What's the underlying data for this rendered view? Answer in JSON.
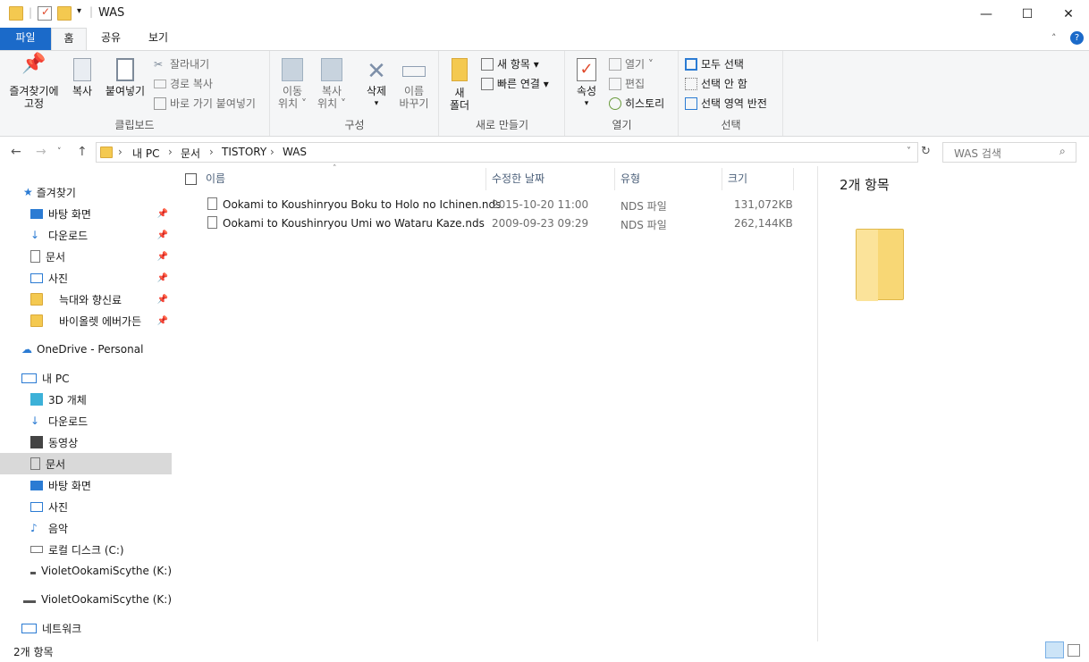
{
  "window": {
    "title": "WAS",
    "minimize_glyph": "—",
    "maximize_glyph": "☐",
    "close_glyph": "✕"
  },
  "ribbon_tabs": [
    "파일",
    "홈",
    "공유",
    "보기"
  ],
  "ribbon": {
    "clipboard": {
      "pin_label": "즐겨찾기에\n고정",
      "copy_label": "복사",
      "paste_label": "붙여넣기",
      "cut_label": "잘라내기",
      "copy_path_label": "경로 복사",
      "paste_shortcut_label": "바로 가기 붙여넣기",
      "group_label": "클립보드"
    },
    "organize": {
      "move_label": "이동\n위치 ˅",
      "copy_to_label": "복사\n위치 ˅",
      "delete_label": "삭제",
      "rename_label": "이름\n바꾸기",
      "group_label": "구성"
    },
    "new": {
      "new_folder_label": "새\n폴더",
      "new_item_label": "새 항목 ▾",
      "easy_access_label": "빠른 연결 ▾",
      "group_label": "새로 만들기"
    },
    "open": {
      "properties_label": "속성",
      "open_label": "열기 ˅",
      "edit_label": "편집",
      "history_label": "히스토리",
      "group_label": "열기"
    },
    "select": {
      "select_all_label": "모두 선택",
      "select_none_label": "선택 안 함",
      "invert_label": "선택 영역 반전",
      "group_label": "선택"
    }
  },
  "address": {
    "breadcrumb": [
      "내 PC",
      "문서",
      "TISTORY",
      "WAS"
    ],
    "search_placeholder": "WAS 검색"
  },
  "nav": {
    "quick_access": "즐겨찾기",
    "pinned": [
      {
        "label": "바탕 화면",
        "icon": "desktop-icon"
      },
      {
        "label": "다운로드",
        "icon": "download-icon"
      },
      {
        "label": "문서",
        "icon": "document-icon"
      },
      {
        "label": "사진",
        "icon": "picture-icon"
      },
      {
        "label": "늑대와 향신료",
        "icon": "folder-icon"
      },
      {
        "label": "바이올렛 에버가든",
        "icon": "folder-icon"
      }
    ],
    "onedrive": "OneDrive - Personal",
    "this_pc": "내 PC",
    "pc_items": [
      {
        "label": "3D 개체",
        "icon": "3d-objects-icon"
      },
      {
        "label": "다운로드",
        "icon": "download-icon"
      },
      {
        "label": "동영상",
        "icon": "video-icon"
      },
      {
        "label": "문서",
        "icon": "document-icon"
      },
      {
        "label": "바탕 화면",
        "icon": "desktop-icon"
      },
      {
        "label": "사진",
        "icon": "picture-icon"
      },
      {
        "label": "음악",
        "icon": "music-icon"
      },
      {
        "label": "로컬 디스크 (C:)",
        "icon": "local-disk-icon"
      },
      {
        "label": "VioletOokamiScythe (K:)",
        "icon": "usb-drive-icon"
      }
    ],
    "drive": "VioletOokamiScythe (K:)",
    "network": "네트워크"
  },
  "columns": {
    "name": "이름",
    "modified": "수정한 날짜",
    "type": "유형",
    "size": "크기"
  },
  "files": [
    {
      "name": "Ookami to Koushinryou Boku to Holo no Ichinen.nds",
      "modified": "2015-10-20 11:00",
      "type": "NDS 파일",
      "size": "131,072KB"
    },
    {
      "name": "Ookami to Koushinryou Umi wo Wataru Kaze.nds",
      "modified": "2009-09-23 09:29",
      "type": "NDS 파일",
      "size": "262,144KB"
    }
  ],
  "preview": {
    "count_label": "2개 항목"
  },
  "status": {
    "count": "2개 항목"
  },
  "colors": {
    "accent": "#1b6ac9",
    "folder": "#f4c950",
    "selected_nav": "#d9d9d9"
  }
}
